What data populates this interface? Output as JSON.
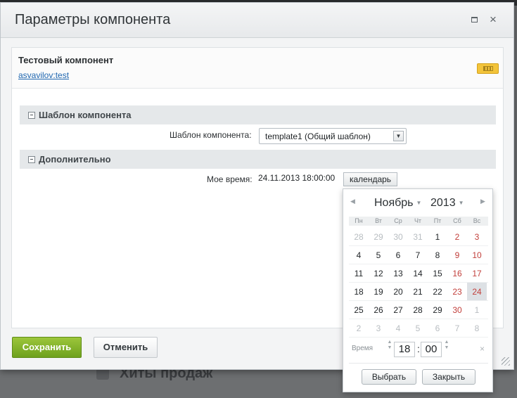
{
  "background": {
    "partial_text": "Хиты продаж"
  },
  "dialog": {
    "title": "Параметры компонента",
    "header_icons": [
      "maximize-icon",
      "close-icon"
    ],
    "close_glyph": "×"
  },
  "component": {
    "name": "Тестовый компонент",
    "link": "asvavilov:test",
    "icon": "keyboard-icon"
  },
  "sections": [
    {
      "title": "Шаблон компонента",
      "toggle_icon": "collapse-minus-icon"
    },
    {
      "title": "Дополнительно",
      "toggle_icon": "collapse-minus-icon"
    }
  ],
  "template_field": {
    "label": "Шаблон компонента:",
    "value": "template1 (Общий шаблон)"
  },
  "time_field": {
    "label": "Мое время:",
    "value": "24.11.2013 18:00:00",
    "button": "календарь"
  },
  "footer": {
    "save": "Сохранить",
    "cancel": "Отменить"
  },
  "calendar": {
    "month": "Ноябрь",
    "year": "2013",
    "weekdays": [
      "Пн",
      "Вт",
      "Ср",
      "Чт",
      "Пт",
      "Сб",
      "Вс"
    ],
    "weeks": [
      [
        "28",
        "29",
        "30",
        "31",
        "1",
        "2",
        "3"
      ],
      [
        "4",
        "5",
        "6",
        "7",
        "8",
        "9",
        "10"
      ],
      [
        "11",
        "12",
        "13",
        "14",
        "15",
        "16",
        "17"
      ],
      [
        "18",
        "19",
        "20",
        "21",
        "22",
        "23",
        "24"
      ],
      [
        "25",
        "26",
        "27",
        "28",
        "29",
        "30",
        "1"
      ],
      [
        "2",
        "3",
        "4",
        "5",
        "6",
        "7",
        "8"
      ]
    ],
    "selected_day": "24",
    "time_label": "Время",
    "hours": "18",
    "minutes": "00",
    "choose": "Выбрать",
    "close": "Закрыть",
    "colors": {
      "weekend": "#c2403c",
      "muted": "#b8bdc1",
      "today_bg": "#dde1e5"
    }
  }
}
